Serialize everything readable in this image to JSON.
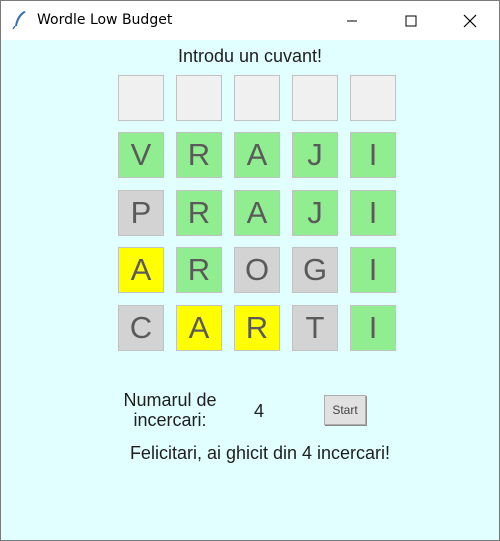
{
  "window": {
    "title": "Wordle Low Budget",
    "icon": "feather-icon",
    "controls": [
      "minimize-icon",
      "maximize-icon",
      "close-icon"
    ]
  },
  "prompt": "Introdu un cuvant!",
  "colors": {
    "background": "#e1ffff",
    "green": "#90ee90",
    "yellow": "#ffff00",
    "gray": "#d3d3d3",
    "empty": "#f0f0f0"
  },
  "grid": [
    [
      {
        "l": "",
        "s": "empty"
      },
      {
        "l": "",
        "s": "empty"
      },
      {
        "l": "",
        "s": "empty"
      },
      {
        "l": "",
        "s": "empty"
      },
      {
        "l": "",
        "s": "empty"
      }
    ],
    [
      {
        "l": "V",
        "s": "green"
      },
      {
        "l": "R",
        "s": "green"
      },
      {
        "l": "A",
        "s": "green"
      },
      {
        "l": "J",
        "s": "green"
      },
      {
        "l": "I",
        "s": "green"
      }
    ],
    [
      {
        "l": "P",
        "s": "gray"
      },
      {
        "l": "R",
        "s": "green"
      },
      {
        "l": "A",
        "s": "green"
      },
      {
        "l": "J",
        "s": "green"
      },
      {
        "l": "I",
        "s": "green"
      }
    ],
    [
      {
        "l": "A",
        "s": "yellow"
      },
      {
        "l": "R",
        "s": "green"
      },
      {
        "l": "O",
        "s": "gray"
      },
      {
        "l": "G",
        "s": "gray"
      },
      {
        "l": "I",
        "s": "green"
      }
    ],
    [
      {
        "l": "C",
        "s": "gray"
      },
      {
        "l": "A",
        "s": "yellow"
      },
      {
        "l": "R",
        "s": "yellow"
      },
      {
        "l": "T",
        "s": "gray"
      },
      {
        "l": "I",
        "s": "green"
      }
    ]
  ],
  "attempts": {
    "label_line1": "Numarul de",
    "label_line2": "incercari:",
    "value": "4"
  },
  "start_button": "Start",
  "message": "Felicitari, ai ghicit din 4 incercari!"
}
